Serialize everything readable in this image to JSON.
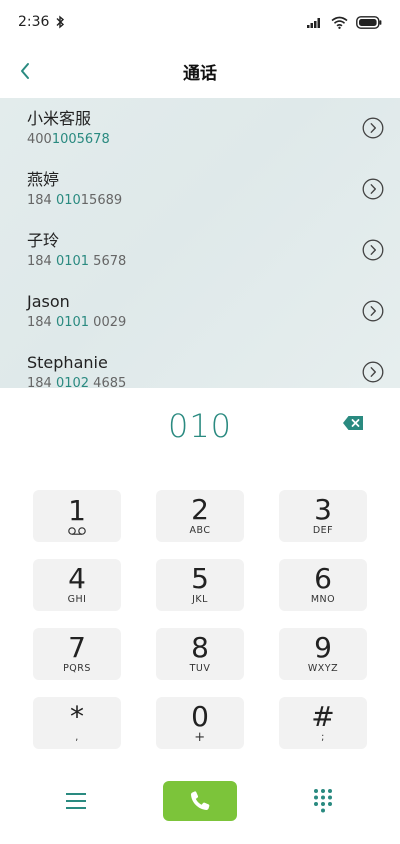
{
  "status_bar": {
    "time": "2:36"
  },
  "header": {
    "title": "通话"
  },
  "results": [
    {
      "name": "小米客服",
      "number_pre": "400",
      "number_match": "1005678",
      "number_post": ""
    },
    {
      "name": "燕婷",
      "number_pre": "184 ",
      "number_match": "010",
      "number_post": "15689"
    },
    {
      "name": "子玲",
      "number_pre": "184 ",
      "number_match": "0101",
      "number_post": " 5678"
    },
    {
      "name": "Jason",
      "number_pre": "184 ",
      "number_match": "0101",
      "number_post": " 0029"
    },
    {
      "name": "Stephanie",
      "number_pre": "184 ",
      "number_match": "0102",
      "number_post": " 4685"
    }
  ],
  "input": {
    "typed": "010"
  },
  "keypad": [
    {
      "digit": "1",
      "letters": ""
    },
    {
      "digit": "2",
      "letters": "ABC"
    },
    {
      "digit": "3",
      "letters": "DEF"
    },
    {
      "digit": "4",
      "letters": "GHI"
    },
    {
      "digit": "5",
      "letters": "JKL"
    },
    {
      "digit": "6",
      "letters": "MNO"
    },
    {
      "digit": "7",
      "letters": "PQRS"
    },
    {
      "digit": "8",
      "letters": "TUV"
    },
    {
      "digit": "9",
      "letters": "WXYZ"
    },
    {
      "digit": "*",
      "letters": ","
    },
    {
      "digit": "0",
      "letters": "+"
    },
    {
      "digit": "#",
      "letters": ";"
    }
  ],
  "colors": {
    "accent": "#2a8a80",
    "call": "#7cc43a"
  },
  "icons": [
    "bluetooth-icon",
    "signal-icon",
    "wifi-icon",
    "battery-icon",
    "back-arrow-icon",
    "chevron-right-circle-icon",
    "backspace-icon",
    "voicemail-icon",
    "menu-icon",
    "phone-icon",
    "dialpad-icon"
  ]
}
